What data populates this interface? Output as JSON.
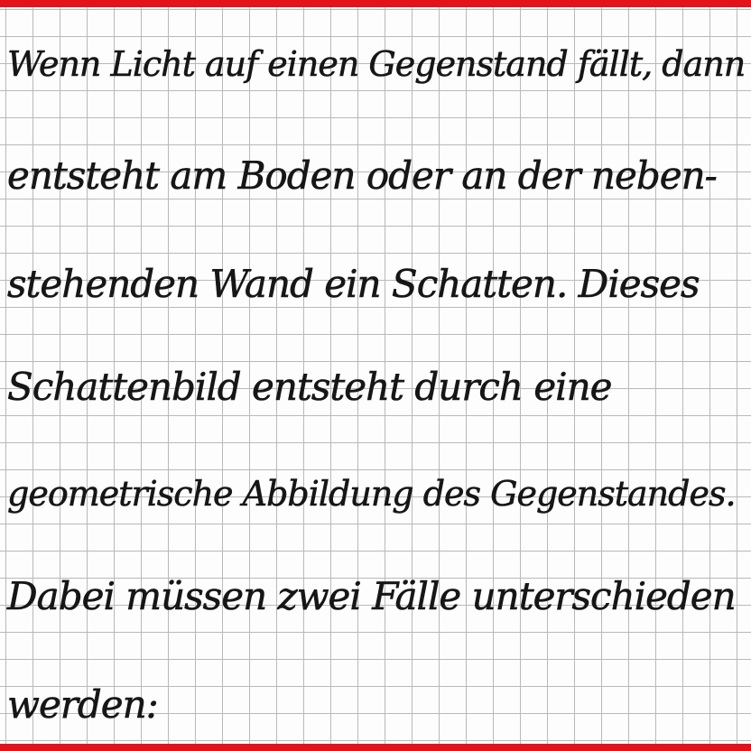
{
  "document": {
    "lines": [
      "Wenn Licht auf einen Gegenstand fällt, dann",
      "entsteht am Boden oder an der neben-",
      "stehenden Wand ein Schatten. Dieses",
      "Schattenbild entsteht durch eine",
      "geometrische Abbildung des Gegenstandes.",
      "Dabei müssen zwei Fälle unterschieden",
      "werden:"
    ]
  },
  "colors": {
    "edge": "#e3131b",
    "grid": "#b9b9b9",
    "ink": "#161616",
    "paper": "#fdfdfd"
  }
}
